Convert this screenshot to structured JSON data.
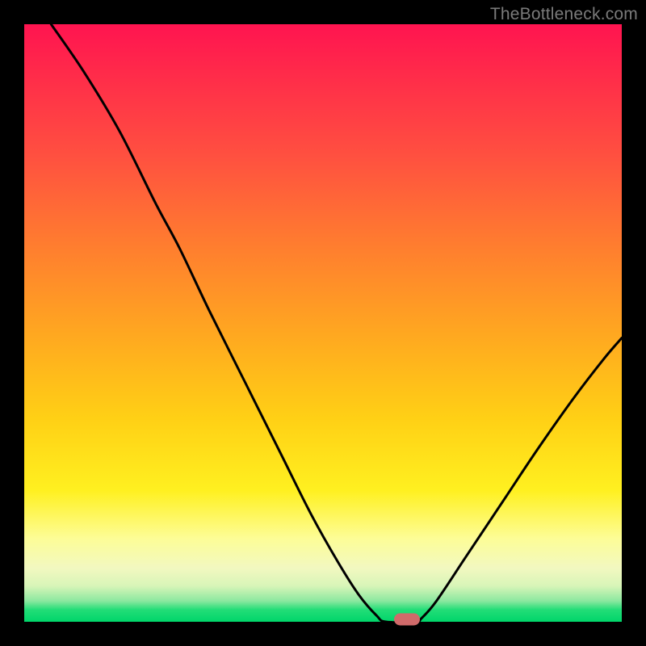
{
  "watermark": "TheBottleneck.com",
  "chart_data": {
    "type": "line",
    "title": "",
    "xlabel": "",
    "ylabel": "",
    "curve_points": [
      {
        "x": 0.045,
        "y": 1.0
      },
      {
        "x": 0.1,
        "y": 0.92
      },
      {
        "x": 0.16,
        "y": 0.82
      },
      {
        "x": 0.22,
        "y": 0.7
      },
      {
        "x": 0.26,
        "y": 0.625
      },
      {
        "x": 0.31,
        "y": 0.52
      },
      {
        "x": 0.37,
        "y": 0.4
      },
      {
        "x": 0.43,
        "y": 0.28
      },
      {
        "x": 0.48,
        "y": 0.18
      },
      {
        "x": 0.525,
        "y": 0.1
      },
      {
        "x": 0.56,
        "y": 0.045
      },
      {
        "x": 0.59,
        "y": 0.01
      },
      {
        "x": 0.605,
        "y": 0.0
      },
      {
        "x": 0.655,
        "y": 0.0
      },
      {
        "x": 0.665,
        "y": 0.006
      },
      {
        "x": 0.69,
        "y": 0.035
      },
      {
        "x": 0.74,
        "y": 0.11
      },
      {
        "x": 0.8,
        "y": 0.2
      },
      {
        "x": 0.86,
        "y": 0.29
      },
      {
        "x": 0.92,
        "y": 0.375
      },
      {
        "x": 0.97,
        "y": 0.44
      },
      {
        "x": 1.0,
        "y": 0.475
      }
    ],
    "marker": {
      "x": 0.64,
      "y": 0.0
    },
    "gradient_stops": [
      {
        "pos": 0.0,
        "color": "#ff1450"
      },
      {
        "pos": 0.5,
        "color": "#ffc020"
      },
      {
        "pos": 0.85,
        "color": "#fdfd96"
      },
      {
        "pos": 1.0,
        "color": "#00d56a"
      }
    ],
    "xlim": [
      0,
      1
    ],
    "ylim": [
      0,
      1
    ]
  }
}
